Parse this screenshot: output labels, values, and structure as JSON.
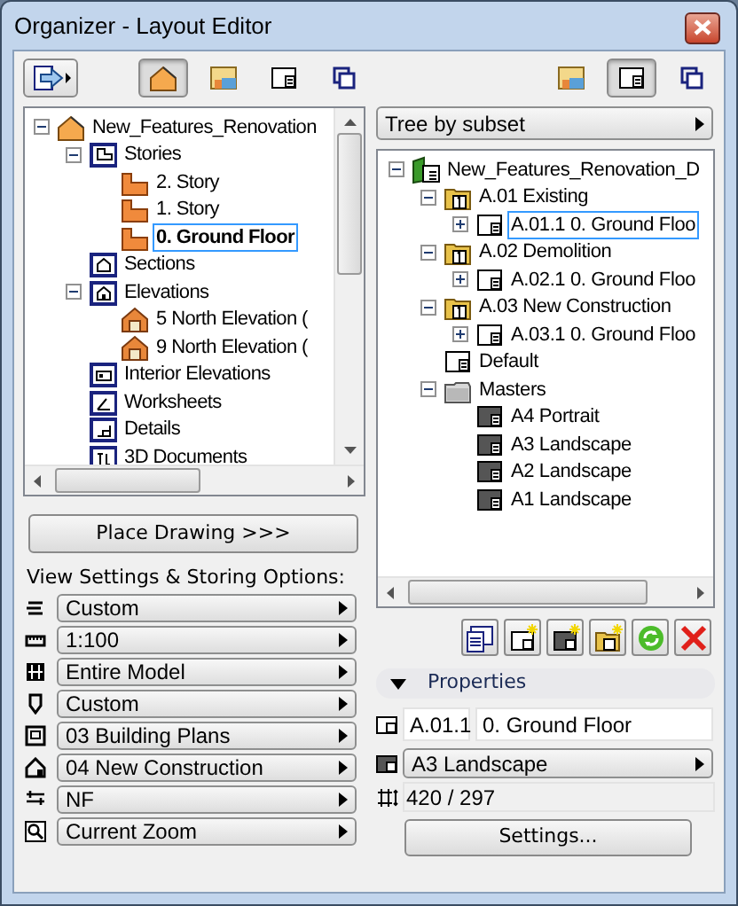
{
  "window": {
    "title": "Organizer - Layout Editor"
  },
  "left_panel": {
    "tabs": [
      {
        "kind": "project",
        "selected": true
      },
      {
        "kind": "view",
        "selected": false
      },
      {
        "kind": "layout",
        "selected": false
      },
      {
        "kind": "publisher",
        "selected": false
      }
    ],
    "tree": [
      {
        "label": "New_Features_Renovation",
        "kind": "project",
        "expanded": true,
        "selected": false,
        "children": [
          {
            "label": "Stories",
            "kind": "folder-stories",
            "expanded": true,
            "selected": false,
            "children": [
              {
                "label": "2. Story",
                "kind": "story",
                "selected": false,
                "current": false
              },
              {
                "label": "1. Story",
                "kind": "story",
                "selected": false,
                "current": false
              },
              {
                "label": "0. Ground Floor",
                "kind": "story",
                "selected": true,
                "current": true
              }
            ]
          },
          {
            "label": "Sections",
            "kind": "folder-sections",
            "selected": false
          },
          {
            "label": "Elevations",
            "kind": "folder-elevations",
            "expanded": true,
            "selected": false,
            "children": [
              {
                "label": "5 North Elevation (",
                "kind": "elevation",
                "selected": false
              },
              {
                "label": "9 North Elevation (",
                "kind": "elevation",
                "selected": false
              }
            ]
          },
          {
            "label": "Interior Elevations",
            "kind": "folder-ie",
            "selected": false
          },
          {
            "label": "Worksheets",
            "kind": "folder-worksheets",
            "selected": false
          },
          {
            "label": "Details",
            "kind": "folder-details",
            "selected": false
          },
          {
            "label": "3D Documents",
            "kind": "folder-3d",
            "selected": false
          }
        ]
      }
    ],
    "place_button": "Place Drawing >>>",
    "options_label": "View Settings & Storing Options:",
    "options": [
      {
        "kind": "layers",
        "value": "Custom"
      },
      {
        "kind": "scale",
        "value": "1:100"
      },
      {
        "kind": "structure",
        "value": "Entire Model"
      },
      {
        "kind": "pen",
        "value": "Custom"
      },
      {
        "kind": "mvo",
        "value": "03 Building Plans"
      },
      {
        "kind": "renovation",
        "value": "04 New Construction"
      },
      {
        "kind": "dimension",
        "value": "NF"
      },
      {
        "kind": "zoom",
        "value": "Current Zoom"
      }
    ]
  },
  "right_panel": {
    "tabs": [
      {
        "kind": "view",
        "selected": false
      },
      {
        "kind": "layout",
        "selected": true
      },
      {
        "kind": "publisher",
        "selected": false
      }
    ],
    "mode": "Tree by subset",
    "tree": [
      {
        "label": "New_Features_Renovation_D",
        "kind": "layout-book",
        "expanded": true,
        "selected": false,
        "children": [
          {
            "label": "A.01 Existing",
            "kind": "subset",
            "expanded": true,
            "selected": false,
            "children": [
              {
                "label": "A.01.1 0. Ground Floo",
                "kind": "layout",
                "expanded": false,
                "selected": true
              }
            ]
          },
          {
            "label": "A.02 Demolition",
            "kind": "subset",
            "expanded": true,
            "selected": false,
            "children": [
              {
                "label": "A.02.1 0. Ground Floo",
                "kind": "layout",
                "expanded": false,
                "selected": false
              }
            ]
          },
          {
            "label": "A.03 New Construction",
            "kind": "subset",
            "expanded": true,
            "selected": false,
            "children": [
              {
                "label": "A.03.1 0. Ground Floo",
                "kind": "layout",
                "expanded": false,
                "selected": false
              }
            ]
          },
          {
            "label": "Default",
            "kind": "layout",
            "selected": false
          },
          {
            "label": "Masters",
            "kind": "master-folder",
            "expanded": true,
            "selected": false,
            "children": [
              {
                "label": "A4 Portrait",
                "kind": "master",
                "selected": false
              },
              {
                "label": "A3 Landscape",
                "kind": "master",
                "selected": false
              },
              {
                "label": "A2 Landscape",
                "kind": "master",
                "selected": false
              },
              {
                "label": "A1 Landscape",
                "kind": "master",
                "selected": false
              }
            ]
          }
        ]
      }
    ],
    "actions": [
      {
        "kind": "list"
      },
      {
        "kind": "new-layout"
      },
      {
        "kind": "new-master"
      },
      {
        "kind": "new-subset"
      },
      {
        "kind": "refresh"
      },
      {
        "kind": "delete"
      }
    ],
    "properties": {
      "title": "Properties",
      "expanded": true,
      "id": "A.01.1",
      "name": "0. Ground Floor",
      "master": "A3 Landscape",
      "size": "420 / 297",
      "settings_button": "Settings..."
    }
  }
}
